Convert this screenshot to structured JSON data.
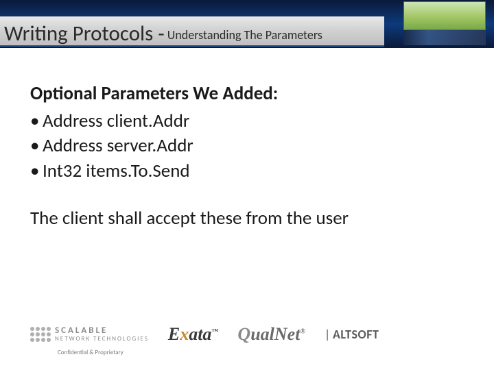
{
  "header": {
    "title_main": "Writing Protocols - ",
    "title_sub": "Understanding The Parameters"
  },
  "content": {
    "heading": "Optional Parameters We Added:",
    "bullets": [
      "Address client.Addr",
      "Address server.Addr",
      "Int32 items.To.Send"
    ],
    "body": "The client shall accept these from the user"
  },
  "footer": {
    "logo_scalable_line1": "SCALABLE",
    "logo_scalable_line2": "NETWORK TECHNOLOGIES",
    "logo_exata": "Exata",
    "logo_qualnet": "QualNet",
    "logo_altsoft": "ALTSOFT",
    "confidential": "Confidential & Proprietary"
  }
}
